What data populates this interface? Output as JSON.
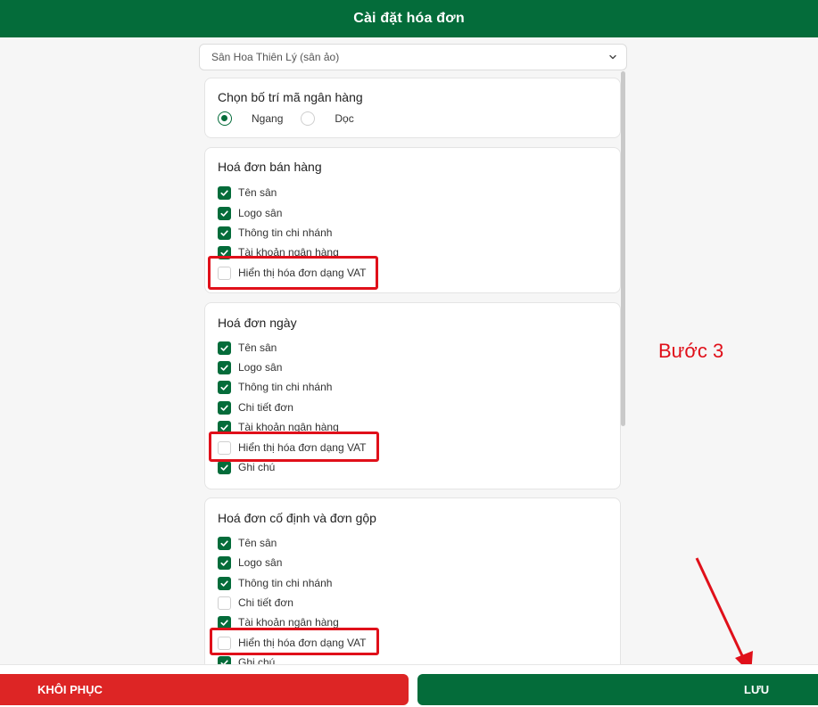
{
  "header": {
    "title": "Cài đặt hóa đơn"
  },
  "venue_select": {
    "value": "Sân Hoa Thiên Lý (sân ảo)",
    "icon": "chevron-down-icon"
  },
  "bank_layout": {
    "title": "Chọn bố trí mã ngân hàng",
    "options": [
      {
        "label": "Ngang",
        "selected": true
      },
      {
        "label": "Dọc",
        "selected": false
      }
    ]
  },
  "sales_invoice": {
    "title": "Hoá đơn bán hàng",
    "items": [
      {
        "label": "Tên sân",
        "checked": true
      },
      {
        "label": "Logo sân",
        "checked": true
      },
      {
        "label": "Thông tin chi nhánh",
        "checked": true
      },
      {
        "label": "Tài khoản ngân hàng",
        "checked": true
      },
      {
        "label": "Hiển thị hóa đơn dạng VAT",
        "checked": false
      }
    ]
  },
  "daily_invoice": {
    "title": "Hoá đơn ngày",
    "items": [
      {
        "label": "Tên sân",
        "checked": true
      },
      {
        "label": "Logo sân",
        "checked": true
      },
      {
        "label": "Thông tin chi nhánh",
        "checked": true
      },
      {
        "label": "Chi tiết đơn",
        "checked": true
      },
      {
        "label": "Tài khoản ngân hàng",
        "checked": true
      },
      {
        "label": "Hiển thị hóa đơn dạng VAT",
        "checked": false
      },
      {
        "label": "Ghi chú",
        "checked": true
      }
    ]
  },
  "fixed_invoice": {
    "title": "Hoá đơn cố định và đơn gộp",
    "items": [
      {
        "label": "Tên sân",
        "checked": true
      },
      {
        "label": "Logo sân",
        "checked": true
      },
      {
        "label": "Thông tin chi nhánh",
        "checked": true
      },
      {
        "label": "Chi tiết đơn",
        "checked": false
      },
      {
        "label": "Tài khoản ngân hàng",
        "checked": true
      },
      {
        "label": "Hiển thị hóa đơn dạng VAT",
        "checked": false
      },
      {
        "label": "Ghi chú",
        "checked": true
      }
    ]
  },
  "annotation": {
    "step_label": "Bước 3"
  },
  "footer": {
    "restore_label": "KHÔI PHỤC",
    "save_label": "LƯU"
  },
  "colors": {
    "brand_green": "#046c3a",
    "danger_red": "#dd2525",
    "highlight_red": "#e0101a"
  }
}
